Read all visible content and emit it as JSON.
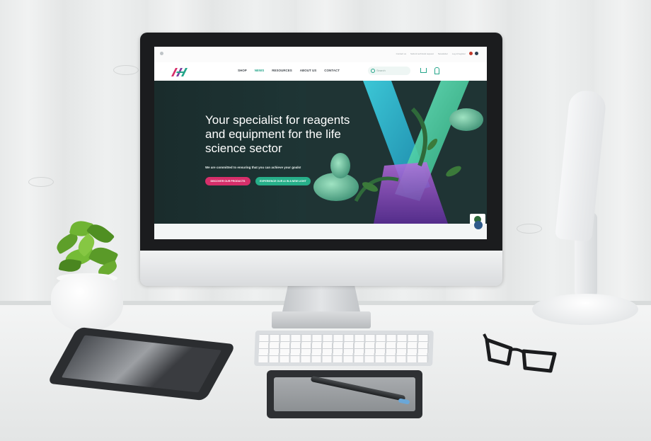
{
  "website": {
    "topbar": {
      "links": [
        "Contact us",
        "Submit technical request",
        "Newsletter",
        "Log in/register"
      ],
      "brand_text": "",
      "language_flags": [
        "en",
        "de"
      ]
    },
    "nav": {
      "items": [
        {
          "label": "SHOP",
          "active": false
        },
        {
          "label": "NEWS",
          "active": true
        },
        {
          "label": "RESOURCES",
          "active": false
        },
        {
          "label": "ABOUT US",
          "active": false
        },
        {
          "label": "CONTACT",
          "active": false
        }
      ],
      "search_placeholder": "Search"
    },
    "hero": {
      "title": "Your specialist for reagents and equipment for the life science sector",
      "subtitle": "We are committed to ensuring that you can achieve your goals!",
      "primary_button": "DISCOVER OUR PRODUCTS",
      "secondary_button": "EXPERIENCE OUR AI IN A NEW LIGHT"
    },
    "badge_text": ""
  },
  "colors": {
    "accent_green": "#24a58a",
    "accent_pink": "#d62f6a",
    "hero_bg": "#1e3535"
  },
  "icons": [
    "logo-icon",
    "search-icon",
    "cart-icon",
    "user-icon",
    "chat-icon"
  ]
}
